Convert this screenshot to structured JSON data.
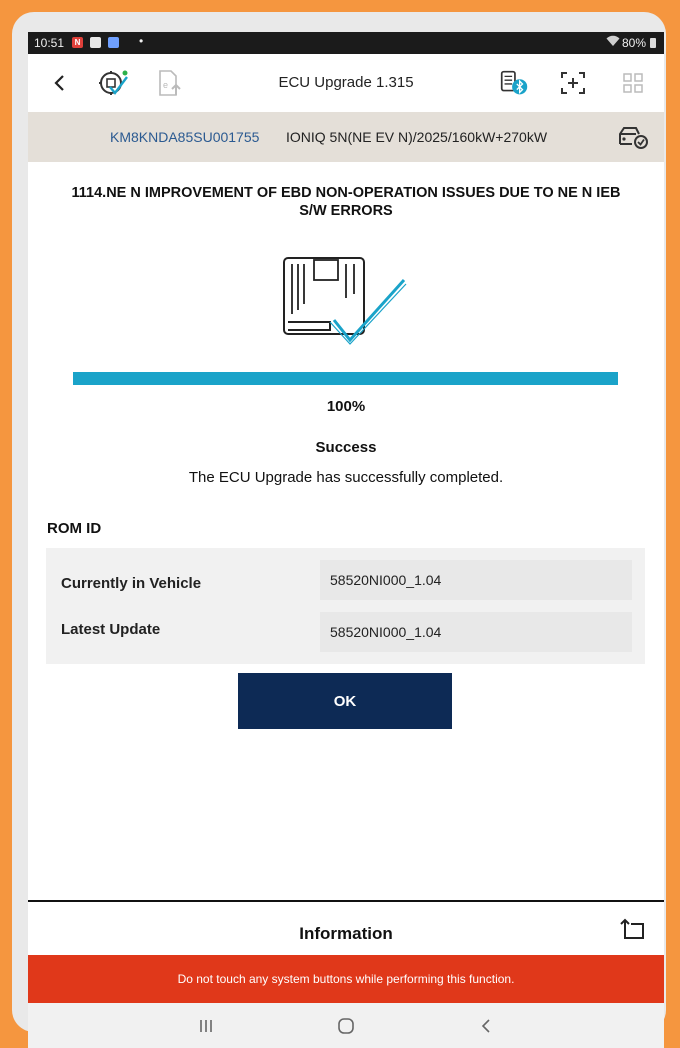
{
  "status_bar": {
    "time": "10:51",
    "calendar_badge": "N",
    "dot": "•",
    "battery": "80%"
  },
  "toolbar": {
    "title": "ECU Upgrade 1.315",
    "icons": [
      "back-icon",
      "ecu-check-icon",
      "file-export-icon",
      "vci-bluetooth-icon",
      "capture-icon",
      "grid-menu-icon"
    ]
  },
  "vehicle": {
    "vin": "KM8KNDA85SU001755",
    "model": "IONIQ 5N(NE EV N)/2025/160kW+270kW"
  },
  "job": {
    "heading_line1": "1114.NE N IMPROVEMENT OF EBD NON-OPERATION ISSUES DUE TO NE N IEB",
    "heading_line2": "S/W ERRORS"
  },
  "progress": {
    "value": 1.0,
    "label": "100%"
  },
  "result": {
    "status": "Success",
    "message": "The ECU Upgrade has successfully completed."
  },
  "rom": {
    "section_label": "ROM ID",
    "rows": [
      {
        "label": "Currently in Vehicle",
        "value": "58520NI000_1.04"
      },
      {
        "label": "Latest Update",
        "value": "58520NI000_1.04"
      }
    ]
  },
  "ok_button": {
    "label": "OK"
  },
  "info_panel": {
    "title": "Information"
  },
  "warning": {
    "text": "Do not touch any system buttons while performing this function."
  },
  "colors": {
    "accent_blue": "#1aa3c9",
    "ok_navy": "#0d2a55",
    "warning_red": "#e0381a",
    "frame_orange": "#f5963f"
  }
}
